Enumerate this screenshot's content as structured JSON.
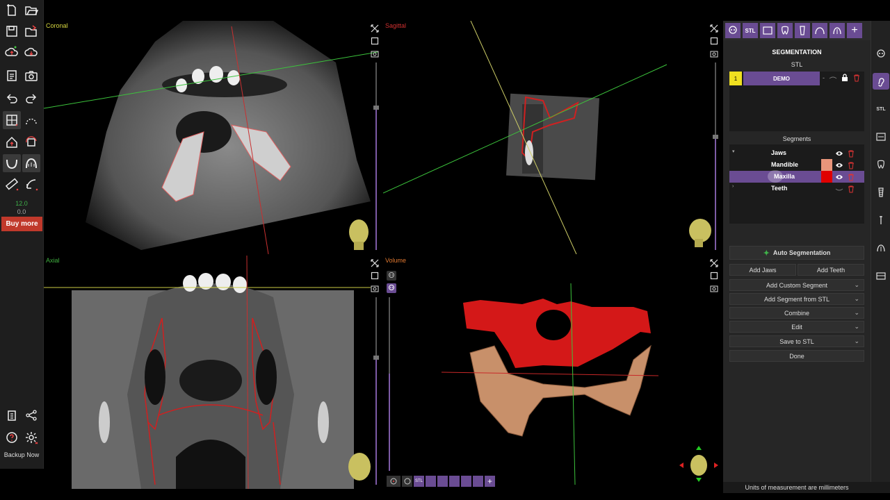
{
  "viewports": {
    "coronal": {
      "label": "Coronal",
      "label_color": "#d8d840"
    },
    "sagittal": {
      "label": "Sagittal",
      "label_color": "#d03030"
    },
    "axial": {
      "label": "Axial",
      "label_color": "#40b040"
    },
    "volume": {
      "label": "Volume",
      "label_color": "#e07830"
    }
  },
  "left_toolbar": {
    "icons": [
      "new-file-icon",
      "open-folder-icon",
      "save-icon",
      "export-folder-icon",
      "cloud-upload-icon",
      "cloud-download-icon",
      "report-icon",
      "camera-icon",
      "undo-icon",
      "redo-icon",
      "layout-icon",
      "curve-icon",
      "home-icon",
      "rotate-icon",
      "jaw-icon",
      "arch-icon",
      "ruler-icon",
      "angle-icon"
    ],
    "value_green": "12.0",
    "value_grey": "0.0",
    "buy_more_label": "Buy more",
    "bottom_icons": [
      "clipboard-icon",
      "share-icon",
      "help-icon",
      "settings-icon"
    ],
    "backup_label": "Backup Now"
  },
  "right_panel": {
    "header": "SEGMENTATION",
    "subheader": "STL",
    "stl_item": {
      "index": "1",
      "name": "DEMO",
      "dash": "-"
    },
    "segments_title": "Segments",
    "segments": [
      {
        "name": "Jaws",
        "color": "",
        "visible": true
      },
      {
        "name": "Mandible",
        "color": "#e8957a",
        "visible": true
      },
      {
        "name": "Maxilla",
        "color": "#e00000",
        "visible": true,
        "selected": true
      },
      {
        "name": "Teeth",
        "color": "",
        "visible": false
      }
    ],
    "auto_segmentation_label": "Auto Segmentation",
    "add_jaws_label": "Add Jaws",
    "add_teeth_label": "Add Teeth",
    "menu_buttons": [
      "Add Custom Segment",
      "Add Segment from STL",
      "Combine",
      "Edit",
      "Save to STL"
    ],
    "done_label": "Done",
    "accent": "#6a4c93"
  },
  "top_right_icons": [
    "skull-icon",
    "stl-icon",
    "panoramic-icon",
    "tooth-icon",
    "implant-icon",
    "arch-icon",
    "airway-icon",
    "plus-icon",
    "settings-list-icon"
  ],
  "far_right_icons": [
    "skull-icon",
    "ear-icon",
    "stl-icon",
    "panoramic-icon",
    "tooth-icon",
    "implant-icon",
    "pin-icon",
    "airway-icon",
    "model-icon"
  ],
  "volume_toolbar_icons": [
    "target-icon",
    "head-icon",
    "stl-icon",
    "panoramic-icon",
    "tooth-icon",
    "implant-icon",
    "arch-icon",
    "airway-icon",
    "plus-icon"
  ],
  "status": {
    "units_text": "Units of measurement are millimeters"
  }
}
